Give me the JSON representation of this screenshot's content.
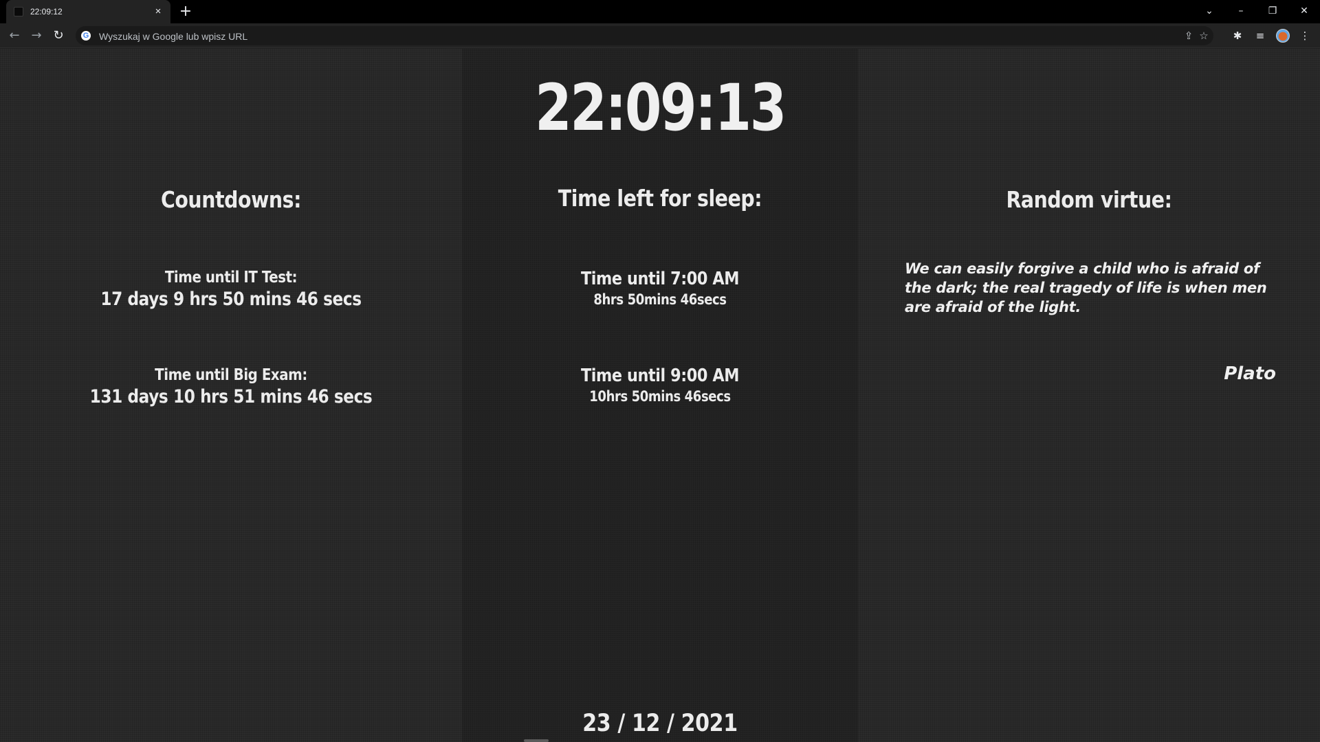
{
  "browser": {
    "tab_title": "22:09:12",
    "tab_close": "×",
    "new_tab": "+",
    "address_placeholder": "Wyszukaj w Google lub wpisz URL",
    "google_letter": "G",
    "window_controls": {
      "tab_search": "⌄",
      "minimize": "–",
      "restore": "❐",
      "close": "✕"
    },
    "nav": {
      "back": "←",
      "forward": "→",
      "reload": "↻"
    },
    "icons": {
      "share": "⇪",
      "bookmark": "☆",
      "extensions": "✱",
      "reading_list": "≡",
      "menu": "⋮"
    }
  },
  "clock": {
    "time": "22:09:13"
  },
  "countdowns": {
    "title": "Countdowns:",
    "items": [
      {
        "label": "Time until IT Test:",
        "value": "17 days 9 hrs 50 mins 46 secs"
      },
      {
        "label": "Time until Big Exam:",
        "value": "131 days 10 hrs 51 mins 46 secs"
      }
    ]
  },
  "sleep": {
    "title": "Time left for sleep:",
    "items": [
      {
        "label": "Time until 7:00 AM",
        "value": "8hrs 50mins 46secs"
      },
      {
        "label": "Time until 9:00 AM",
        "value": "10hrs 50mins 46secs"
      }
    ]
  },
  "virtue": {
    "title": "Random virtue:",
    "quote": "We can easily forgive a child who is afraid of the dark; the real tragedy of life is when men are afraid of the light.",
    "author": "Plato"
  },
  "date": {
    "text": "23 / 12 / 2021"
  },
  "colors": {
    "page_background": "#282828",
    "center_column": "#232323",
    "text": "#ececec",
    "browser_frame": "#000000"
  }
}
